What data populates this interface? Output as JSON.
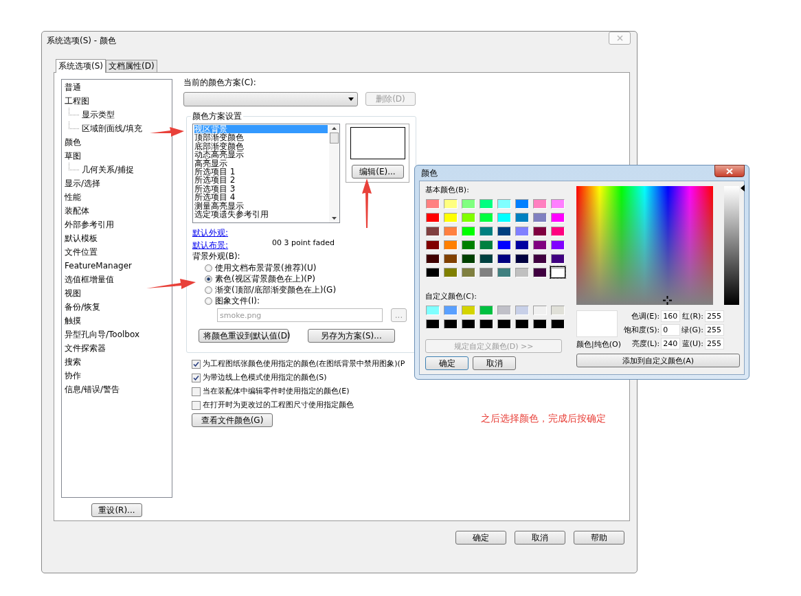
{
  "window": {
    "title": "系统选项(S) - 颜色"
  },
  "tabs": [
    {
      "label": "系统选项(S)",
      "selected": true
    },
    {
      "label": "文档属性(D)",
      "selected": false
    }
  ],
  "sidebar": {
    "items": [
      {
        "label": "普通"
      },
      {
        "label": "工程图",
        "children": [
          {
            "label": "显示类型"
          },
          {
            "label": "区域剖面线/填充"
          }
        ]
      },
      {
        "label": "颜色"
      },
      {
        "label": "草图",
        "children": [
          {
            "label": "几何关系/捕捉"
          }
        ]
      },
      {
        "label": "显示/选择"
      },
      {
        "label": "性能"
      },
      {
        "label": "装配体"
      },
      {
        "label": "外部参考引用"
      },
      {
        "label": "默认模板"
      },
      {
        "label": "文件位置"
      },
      {
        "label": "FeatureManager"
      },
      {
        "label": "选值框增量值"
      },
      {
        "label": "视图"
      },
      {
        "label": "备份/恢复"
      },
      {
        "label": "触摸"
      },
      {
        "label": "异型孔向导/Toolbox"
      },
      {
        "label": "文件探索器"
      },
      {
        "label": "搜索"
      },
      {
        "label": "协作"
      },
      {
        "label": "信息/错误/警告"
      }
    ],
    "reset_button": "重设(R)..."
  },
  "scheme": {
    "label": "当前的颜色方案(C):",
    "delete_button": {
      "label": "删除(D)",
      "disabled": true
    }
  },
  "scheme_settings": {
    "title": "颜色方案设置",
    "items": [
      {
        "label": "视区背景",
        "selected": true
      },
      {
        "label": "顶部渐变颜色",
        "selected": false
      },
      {
        "label": "底部渐变颜色",
        "selected": false
      },
      {
        "label": "动态高亮显示",
        "selected": false
      },
      {
        "label": "高亮显示",
        "selected": false
      },
      {
        "label": "所选项目 1",
        "selected": false
      },
      {
        "label": "所选项目 2",
        "selected": false
      },
      {
        "label": "所选项目 3",
        "selected": false
      },
      {
        "label": "所选项目 4",
        "selected": false
      },
      {
        "label": "测量高亮显示",
        "selected": false
      },
      {
        "label": "选定项遗失参考引用",
        "selected": false
      }
    ],
    "edit_button": "编辑(E)...",
    "default_appearance_link": "默认外观:",
    "default_scene_link": "默认布景:",
    "default_scene_value": "00 3 point faded",
    "background_label": "背景外观(B):",
    "background_options": [
      {
        "label": "使用文档布景背景(推荐)(U)",
        "selected": false
      },
      {
        "label": "素色(视区背景颜色在上)(P)",
        "selected": true
      },
      {
        "label": "渐变(顶部/底部渐变颜色在上)(G)",
        "selected": false
      },
      {
        "label": "图象文件(I):",
        "selected": false
      }
    ],
    "image_file": {
      "value": "smoke.png",
      "disabled": true
    },
    "browse_button": "...",
    "reset_colors_button": "将颜色重设到默认值(D)",
    "save_scheme_button": "另存为方案(S)..."
  },
  "checkboxes": [
    {
      "label": "为工程图纸张颜色使用指定的颜色(在图纸背景中禁用图象)(P",
      "checked": true
    },
    {
      "label": "为带边线上色模式使用指定的颜色(S)",
      "checked": true
    },
    {
      "label": "当在装配体中编辑零件时使用指定的颜色(E)",
      "checked": false
    },
    {
      "label": "在打开时为更改过的工程图尺寸使用指定颜色",
      "checked": false
    }
  ],
  "view_file_colors_button": "查看文件颜色(G)",
  "note": "之后选择颜色，完成后按确定",
  "buttons": [
    "确定",
    "取消",
    "帮助"
  ],
  "color_dialog": {
    "title": "颜色",
    "basic_label": "基本颜色(B):",
    "basic_colors": [
      {
        "color": "#ff8080",
        "selected": false
      },
      {
        "color": "#ffff80",
        "selected": false
      },
      {
        "color": "#80ff80",
        "selected": false
      },
      {
        "color": "#00ff80",
        "selected": false
      },
      {
        "color": "#80ffff",
        "selected": false
      },
      {
        "color": "#0080ff",
        "selected": false
      },
      {
        "color": "#ff80c0",
        "selected": false
      },
      {
        "color": "#ff80ff",
        "selected": false
      },
      {
        "color": "#ff0000",
        "selected": false
      },
      {
        "color": "#ffff00",
        "selected": false
      },
      {
        "color": "#80ff00",
        "selected": false
      },
      {
        "color": "#00ff40",
        "selected": false
      },
      {
        "color": "#00ffff",
        "selected": false
      },
      {
        "color": "#0080c0",
        "selected": false
      },
      {
        "color": "#8080c0",
        "selected": false
      },
      {
        "color": "#ff00ff",
        "selected": false
      },
      {
        "color": "#804040",
        "selected": false
      },
      {
        "color": "#ff8040",
        "selected": false
      },
      {
        "color": "#00ff00",
        "selected": false
      },
      {
        "color": "#008080",
        "selected": false
      },
      {
        "color": "#004080",
        "selected": false
      },
      {
        "color": "#8080ff",
        "selected": false
      },
      {
        "color": "#800040",
        "selected": false
      },
      {
        "color": "#ff0080",
        "selected": false
      },
      {
        "color": "#800000",
        "selected": false
      },
      {
        "color": "#ff8000",
        "selected": false
      },
      {
        "color": "#008000",
        "selected": false
      },
      {
        "color": "#008040",
        "selected": false
      },
      {
        "color": "#0000ff",
        "selected": false
      },
      {
        "color": "#0000a0",
        "selected": false
      },
      {
        "color": "#800080",
        "selected": false
      },
      {
        "color": "#8000ff",
        "selected": false
      },
      {
        "color": "#400000",
        "selected": false
      },
      {
        "color": "#804000",
        "selected": false
      },
      {
        "color": "#004000",
        "selected": false
      },
      {
        "color": "#004040",
        "selected": false
      },
      {
        "color": "#000080",
        "selected": false
      },
      {
        "color": "#000040",
        "selected": false
      },
      {
        "color": "#400040",
        "selected": false
      },
      {
        "color": "#400080",
        "selected": false
      },
      {
        "color": "#000000",
        "selected": false
      },
      {
        "color": "#808000",
        "selected": false
      },
      {
        "color": "#808040",
        "selected": false
      },
      {
        "color": "#808080",
        "selected": false
      },
      {
        "color": "#408080",
        "selected": false
      },
      {
        "color": "#c0c0c0",
        "selected": false
      },
      {
        "color": "#400040",
        "selected": false
      },
      {
        "color": "#ffffff",
        "selected": true
      }
    ],
    "custom_label": "自定义颜色(C):",
    "custom_colors": [
      {
        "color": "#80ffff"
      },
      {
        "color": "#5aa0ff"
      },
      {
        "color": "#d4d400"
      },
      {
        "color": "#00c040"
      },
      {
        "color": "#c0c0c8"
      },
      {
        "color": "#c8d0e8"
      },
      {
        "color": "#f0f0f0"
      },
      {
        "color": "#e0e0d8"
      },
      {
        "color": "#000000"
      },
      {
        "color": "#000000"
      },
      {
        "color": "#000000"
      },
      {
        "color": "#000000"
      },
      {
        "color": "#000000"
      },
      {
        "color": "#000000"
      },
      {
        "color": "#000000"
      },
      {
        "color": "#000000"
      }
    ],
    "define_button": {
      "label": "规定自定义颜色(D) >>",
      "disabled": true
    },
    "ok_button": "确定",
    "cancel_button": "取消",
    "preview_label": "颜色|纯色(O)",
    "fields": [
      {
        "label": "色调(E):",
        "value": "160"
      },
      {
        "label": "红(R):",
        "value": "255"
      },
      {
        "label": "饱和度(S):",
        "value": "0"
      },
      {
        "label": "绿(G):",
        "value": "255"
      },
      {
        "label": "亮度(L):",
        "value": "240"
      },
      {
        "label": "蓝(U):",
        "value": "255"
      }
    ],
    "add_button": "添加到自定义颜色(A)"
  }
}
